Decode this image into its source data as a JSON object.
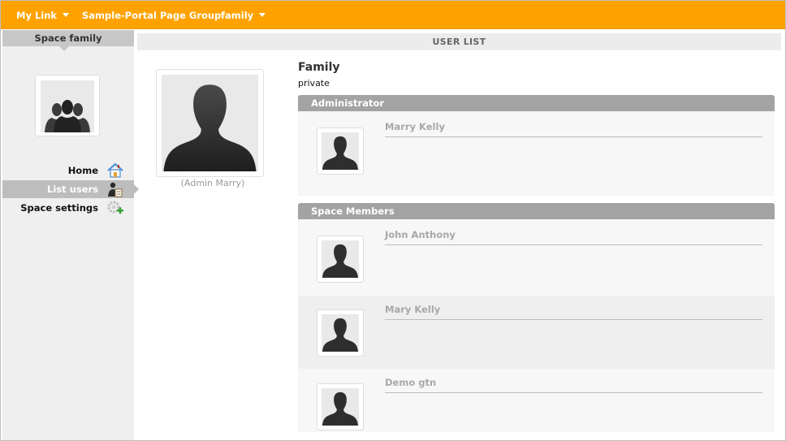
{
  "topnav": {
    "my_link": "My Link",
    "page_group": "Sample-Portal Page Group",
    "family": "family"
  },
  "sidebar": {
    "title": "Space family",
    "avatar_icon": "group-silhouette-icon",
    "items": [
      {
        "label": "Home",
        "icon": "house-icon",
        "active": false
      },
      {
        "label": "List users",
        "icon": "user-list-icon",
        "active": true
      },
      {
        "label": "Space settings",
        "icon": "settings-add-icon",
        "active": false
      }
    ]
  },
  "main": {
    "header": "USER LIST",
    "owner_caption": "(Admin Marry)",
    "space_name": "Family",
    "space_type": "private",
    "administrator_section": {
      "title": "Administrator",
      "members": [
        {
          "name": "Marry Kelly"
        }
      ]
    },
    "members_section": {
      "title": "Space Members",
      "members": [
        {
          "name": "John Anthony"
        },
        {
          "name": "Mary Kelly"
        },
        {
          "name": "Demo gtn"
        }
      ]
    }
  },
  "colors": {
    "topbar": "#ffa200",
    "section_bar": "#a3a3a3",
    "sidebar_active": "#bdbdbd"
  }
}
